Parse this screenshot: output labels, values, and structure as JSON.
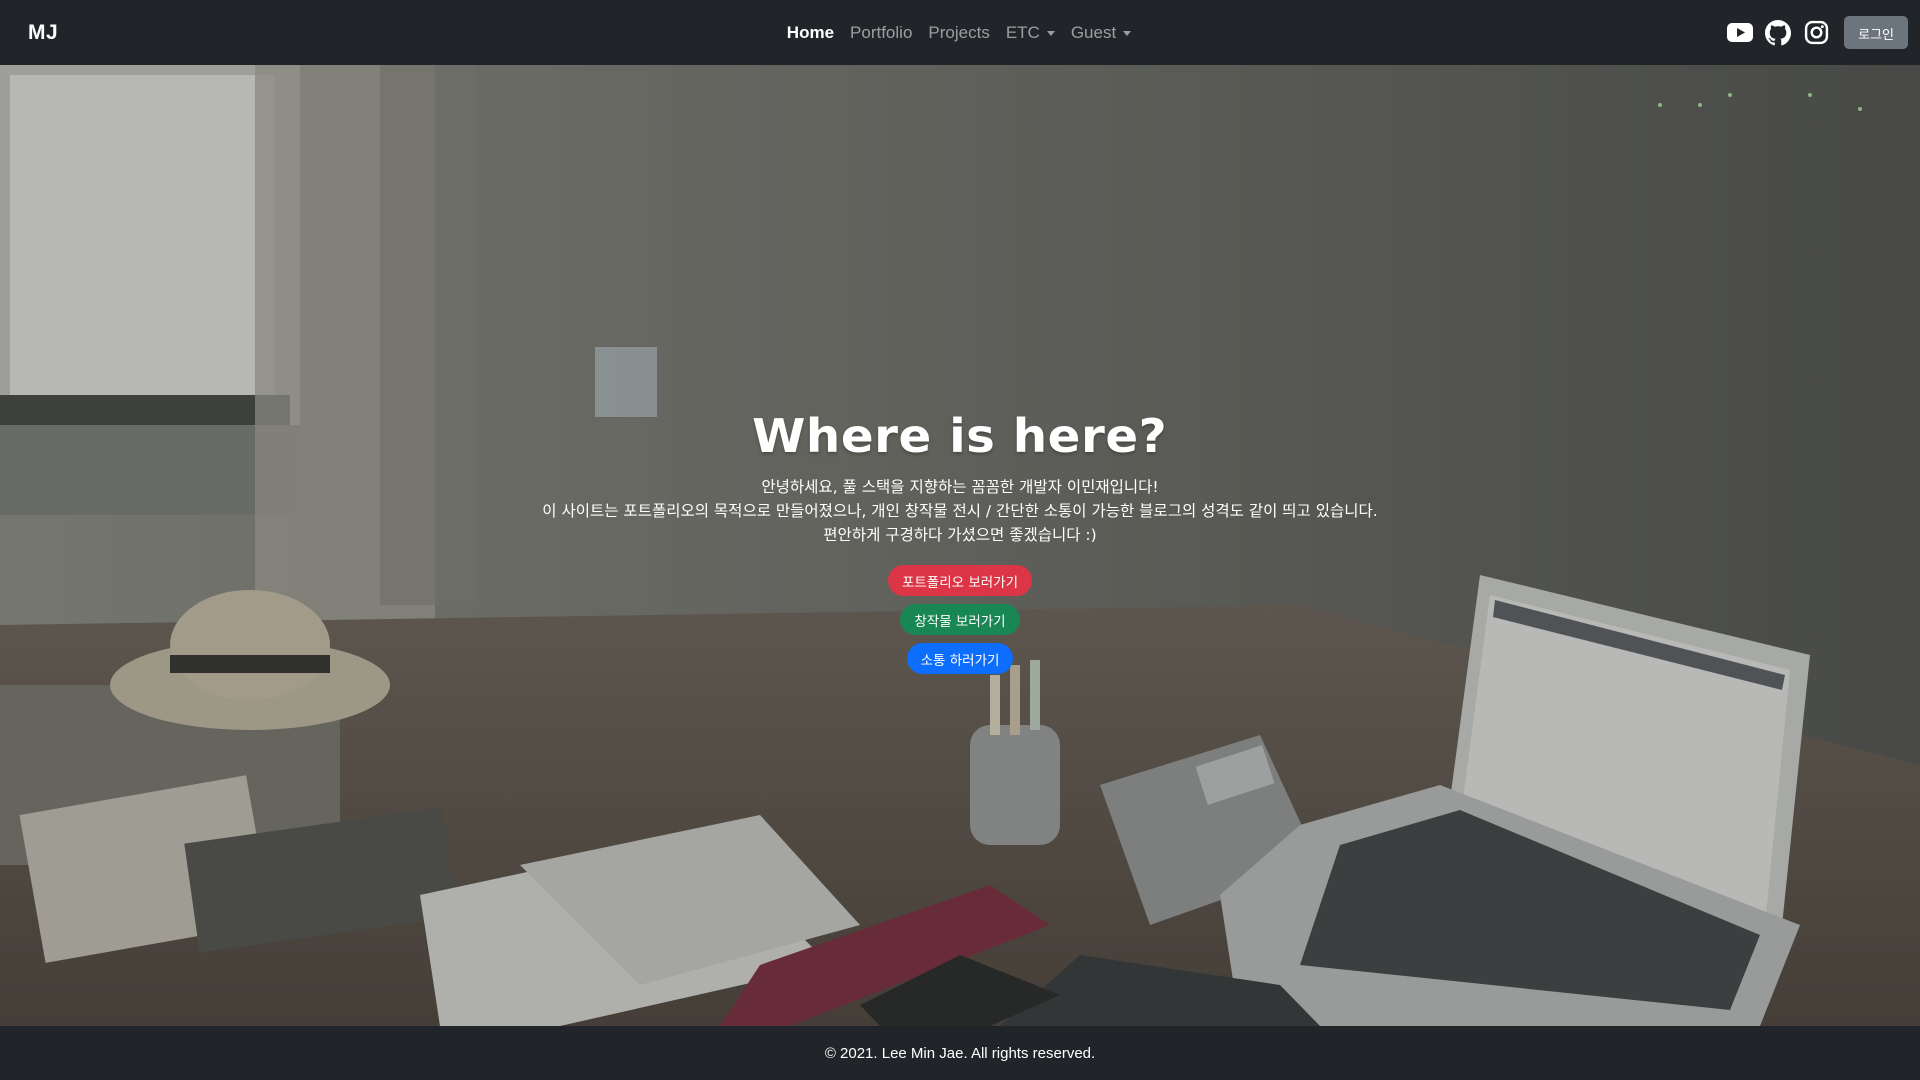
{
  "navbar": {
    "brand": "MJ",
    "links": [
      {
        "label": "Home",
        "active": true,
        "dropdown": false
      },
      {
        "label": "Portfolio",
        "active": false,
        "dropdown": false
      },
      {
        "label": "Projects",
        "active": false,
        "dropdown": false
      },
      {
        "label": "ETC",
        "active": false,
        "dropdown": true
      },
      {
        "label": "Guest",
        "active": false,
        "dropdown": true
      }
    ],
    "social_icons": [
      "youtube-icon",
      "github-icon",
      "instagram-icon"
    ],
    "login_label": "로그인"
  },
  "hero": {
    "title": "Where is here?",
    "lines": [
      "안녕하세요, 풀 스택을 지향하는 꼼꼼한 개발자 이민재입니다!",
      "이 사이트는 포트폴리오의 목적으로 만들어졌으나, 개인 창작물 전시 / 간단한 소통이 가능한 블로그의 성격도 같이 띄고 있습니다.",
      "편안하게 구경하다 가셨으면 좋겠습니다 :)"
    ],
    "buttons": [
      {
        "label": "포트폴리오 보러가기",
        "color": "#dc3545"
      },
      {
        "label": "창작물 보러가기",
        "color": "#198754"
      },
      {
        "label": "소통 하러가기",
        "color": "#0d6efd"
      }
    ]
  },
  "footer": {
    "copyright": "© 2021. Lee Min Jae. All rights reserved."
  },
  "colors": {
    "navbar_bg": "#212529",
    "login_button": "#6c757d"
  }
}
